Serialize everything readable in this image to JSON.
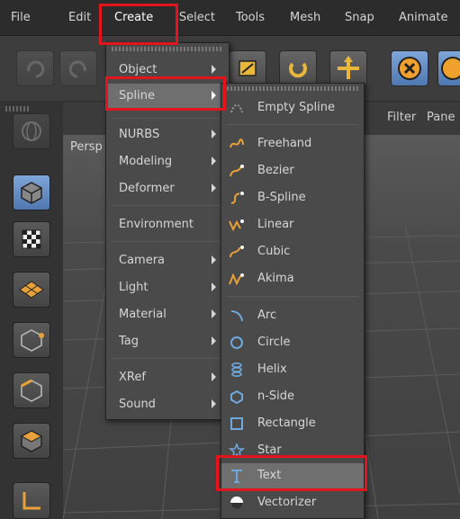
{
  "menubar": {
    "items": [
      "File",
      "Edit",
      "Create",
      "Select",
      "Tools",
      "Mesh",
      "Snap",
      "Animate"
    ]
  },
  "viewbar": {
    "filter": "Filter",
    "panel": "Pane"
  },
  "viewport": {
    "label": "Persp"
  },
  "create_menu": {
    "items": [
      {
        "label": "Object",
        "submenu": true
      },
      {
        "label": "Spline",
        "submenu": true,
        "highlighted": true
      },
      {
        "label": "NURBS",
        "submenu": true
      },
      {
        "label": "Modeling",
        "submenu": true
      },
      {
        "label": "Deformer",
        "submenu": true
      },
      {
        "label": "Environment",
        "submenu": true
      },
      {
        "label": "Camera",
        "submenu": true
      },
      {
        "label": "Light",
        "submenu": true
      },
      {
        "label": "Material",
        "submenu": true
      },
      {
        "label": "Tag",
        "submenu": true
      },
      {
        "label": "XRef",
        "submenu": true
      },
      {
        "label": "Sound",
        "submenu": true
      }
    ]
  },
  "spline_menu": {
    "items": [
      {
        "label": "Empty Spline",
        "icon": "empty-spline-icon"
      },
      {
        "label": "Freehand",
        "icon": "freehand-icon"
      },
      {
        "label": "Bezier",
        "icon": "bezier-icon"
      },
      {
        "label": "B-Spline",
        "icon": "b-spline-icon"
      },
      {
        "label": "Linear",
        "icon": "linear-icon"
      },
      {
        "label": "Cubic",
        "icon": "cubic-icon"
      },
      {
        "label": "Akima",
        "icon": "akima-icon"
      },
      {
        "label": "Arc",
        "icon": "arc-icon"
      },
      {
        "label": "Circle",
        "icon": "circle-icon"
      },
      {
        "label": "Helix",
        "icon": "helix-icon"
      },
      {
        "label": "n-Side",
        "icon": "n-side-icon"
      },
      {
        "label": "Rectangle",
        "icon": "rectangle-icon"
      },
      {
        "label": "Star",
        "icon": "star-icon"
      },
      {
        "label": "Text",
        "icon": "text-icon",
        "highlighted": true
      },
      {
        "label": "Vectorizer",
        "icon": "vectorizer-icon"
      }
    ]
  },
  "colors": {
    "accent_red": "#e3141b",
    "spline_orange": "#e8a13a",
    "spline_blue": "#6fa8dc"
  }
}
